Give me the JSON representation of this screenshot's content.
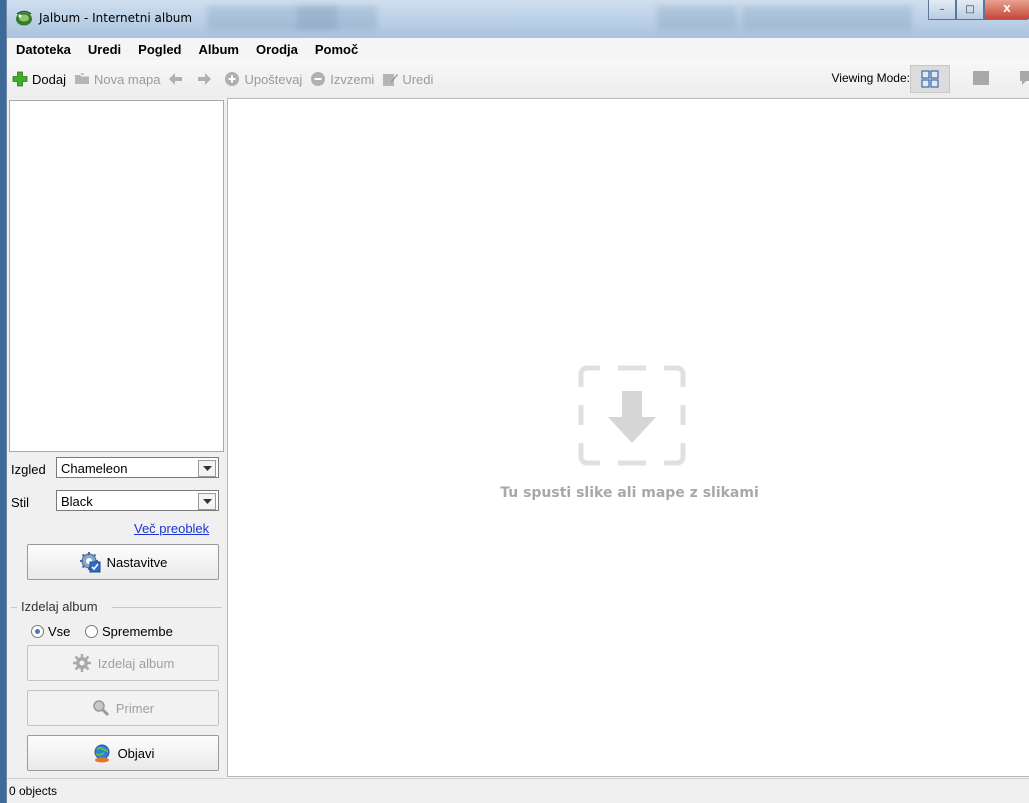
{
  "window": {
    "title": "Jalbum - Internetni album",
    "minimize": "–",
    "maximize": "□",
    "close": "X"
  },
  "menu": [
    "Datoteka",
    "Uredi",
    "Pogled",
    "Album",
    "Orodja",
    "Pomoč"
  ],
  "toolbar": {
    "add": "Dodaj",
    "new_folder": "Nova mapa",
    "include": "Upoštevaj",
    "exclude": "Izvzemi",
    "edit": "Uredi",
    "viewing_mode_label": "Viewing Mode:"
  },
  "sidebar": {
    "skin_label": "Izgled",
    "skin_value": "Chameleon",
    "style_label": "Stil",
    "style_value": "Black",
    "more_skins_link": "Več preoblek",
    "settings_button": "Nastavitve",
    "make_album_group": "Izdelaj album",
    "radio_all": "Vse",
    "radio_changes": "Spremembe",
    "make_album_button": "Izdelaj album",
    "preview_button": "Primer",
    "publish_button": "Objavi"
  },
  "main": {
    "drop_hint": "Tu spusti slike ali mape z slikami"
  },
  "status": {
    "text": "0 objects"
  }
}
